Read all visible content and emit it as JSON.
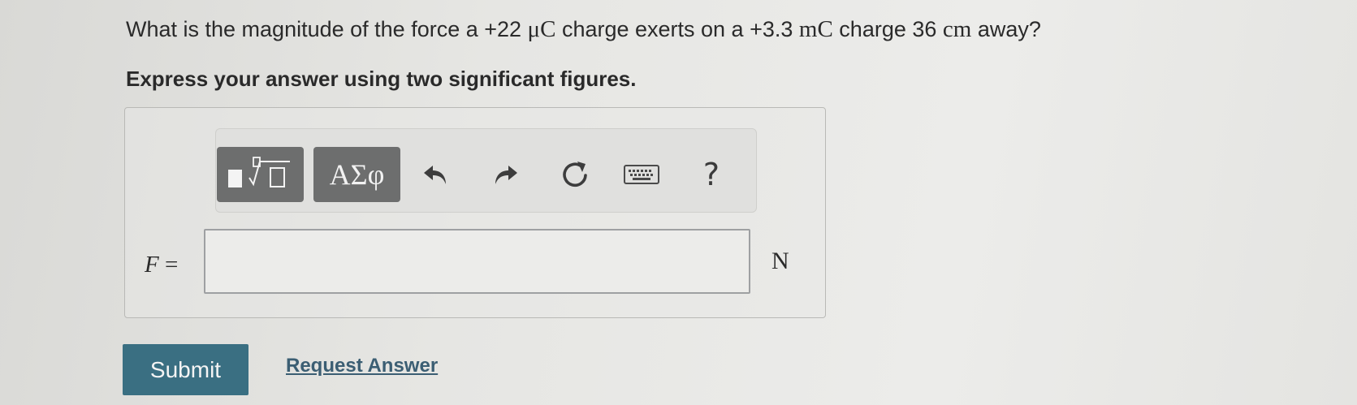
{
  "question": {
    "p1": "What is the magnitude of the force a +22 ",
    "m1": "μC",
    "p2": " charge exerts on a +3.3 ",
    "m2": "mC",
    "p3": " charge 36 ",
    "m3": "cm",
    "p4": " away?"
  },
  "instruction": "Express your answer using two significant figures.",
  "toolbar": {
    "greek_label": "ΑΣφ",
    "help_label": "?",
    "icons": [
      "templates-icon",
      "undo-icon",
      "redo-icon",
      "reset-icon",
      "keyboard-icon",
      "help-icon"
    ]
  },
  "answer": {
    "variable": "F",
    "equals": " =",
    "value": "",
    "placeholder": "",
    "unit": "N"
  },
  "actions": {
    "submit_label": "Submit",
    "request_label": "Request Answer"
  },
  "colors": {
    "submit_bg": "#3a6f82",
    "toolbar_button_bg": "#6d6e6e",
    "link": "#3b5e73"
  }
}
